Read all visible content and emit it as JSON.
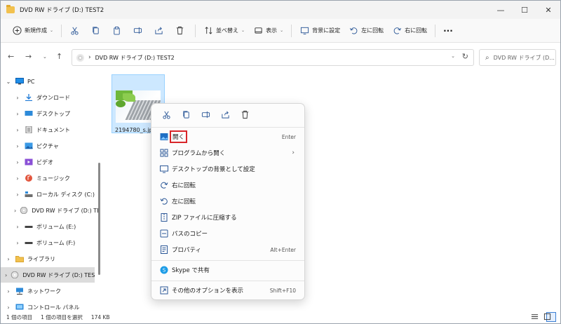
{
  "window": {
    "title": "DVD RW ドライブ (D:) TEST2",
    "minimize": "—",
    "maximize": "☐",
    "close": "✕"
  },
  "toolbar": {
    "new_label": "新規作成",
    "sort_label": "並べ替え",
    "view_label": "表示",
    "set_bg_label": "背景に設定",
    "rotate_left_label": "左に回転",
    "rotate_right_label": "右に回転",
    "more": "···"
  },
  "address": {
    "path": "DVD RW ドライブ (D:) TEST2",
    "separator": "›"
  },
  "search": {
    "placeholder": "DVD RW ドライブ (D..."
  },
  "sidebar": {
    "items": [
      {
        "label": "PC",
        "expander": "⌄"
      },
      {
        "label": "ダウンロード",
        "expander": "›"
      },
      {
        "label": "デスクトップ",
        "expander": "›"
      },
      {
        "label": "ドキュメント",
        "expander": "›"
      },
      {
        "label": "ピクチャ",
        "expander": "›"
      },
      {
        "label": "ビデオ",
        "expander": "›"
      },
      {
        "label": "ミュージック",
        "expander": "›"
      },
      {
        "label": "ローカル ディスク (C:)",
        "expander": "›"
      },
      {
        "label": "DVD RW ドライブ (D:) TE",
        "expander": "›"
      },
      {
        "label": "ボリューム (E:)",
        "expander": "›"
      },
      {
        "label": "ボリューム (F:)",
        "expander": "›"
      },
      {
        "label": "ライブラリ",
        "expander": "›"
      },
      {
        "label": "DVD RW ドライブ (D:) TES",
        "expander": "›"
      },
      {
        "label": "ネットワーク",
        "expander": "›"
      },
      {
        "label": "コントロール パネル",
        "expander": "›"
      }
    ]
  },
  "file": {
    "name": "2194780_s.jpg"
  },
  "context_menu": {
    "items": [
      {
        "label": "開く",
        "shortcut": "Enter"
      },
      {
        "label": "プログラムから開く",
        "submenu": "›"
      },
      {
        "label": "デスクトップの背景として設定"
      },
      {
        "label": "右に回転"
      },
      {
        "label": "左に回転"
      },
      {
        "label": "ZIP ファイルに圧縮する"
      },
      {
        "label": "パスのコピー"
      },
      {
        "label": "プロパティ",
        "shortcut": "Alt+Enter"
      },
      {
        "label": "Skype で共有"
      },
      {
        "label": "その他のオプションを表示",
        "shortcut": "Shift+F10"
      }
    ]
  },
  "status": {
    "count": "1 個の項目",
    "selected": "1 個の項目を選択",
    "size": "174 KB"
  },
  "colors": {
    "accent": "#0067c0",
    "highlight": "#d8262a",
    "selection": "#cde8ff"
  }
}
